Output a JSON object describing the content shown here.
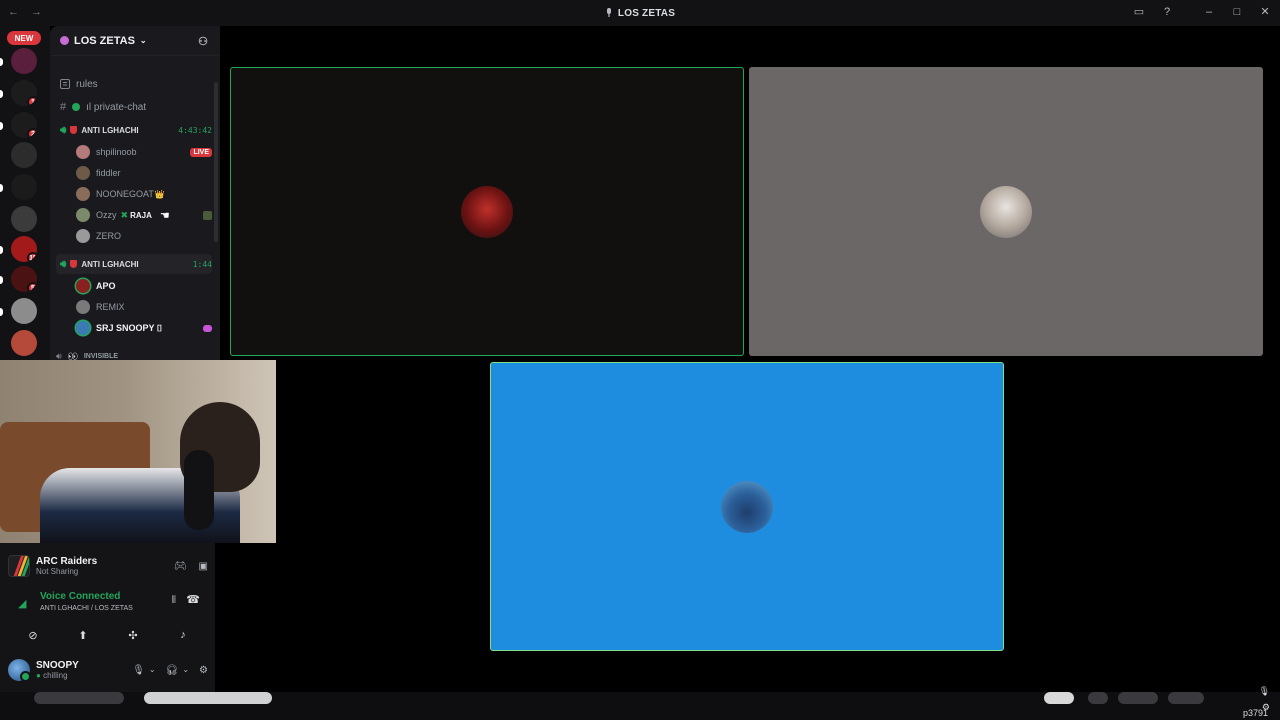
{
  "window": {
    "title": "LOS ZETAS",
    "nav_back": "←",
    "nav_forward": "→",
    "controls": [
      "inbox-icon",
      "help-icon",
      "minimize",
      "maximize",
      "close"
    ]
  },
  "rail": {
    "new_badge": "NEW",
    "servers": [
      {
        "badge": "",
        "color": "#5a1f3c"
      },
      {
        "badge": "1",
        "color": "#1c1c1c"
      },
      {
        "badge": "2",
        "color": "#1c1c1c"
      },
      {
        "badge": "",
        "color": "#2c2c2c"
      },
      {
        "badge": "",
        "color": "#1b1b1b"
      },
      {
        "badge": "",
        "color": "#3b3b3b"
      },
      {
        "badge": "15",
        "color": "#a31a1a"
      },
      {
        "badge": "5",
        "color": "#4a1212"
      },
      {
        "badge": "",
        "color": "#8c8c8c"
      },
      {
        "badge": "",
        "color": "#b54a3a"
      }
    ]
  },
  "sidebar": {
    "server_name": "LOS ZETAS",
    "channels": [
      {
        "label": "rules"
      },
      {
        "label": "ıl private-chat"
      }
    ],
    "voice1": {
      "name": "ANTI LGHACHI",
      "timer": "4:43:42",
      "users": [
        {
          "name": "shpilinoob",
          "tag": "LIVE",
          "color": "#b57a7a"
        },
        {
          "name": "fiddler",
          "tag": "",
          "color": "#6d5b48"
        },
        {
          "name": "NOONEGOAT",
          "tag": "👑",
          "color": "#8a6c5a"
        },
        {
          "name": "Ozzy",
          "tag": "RAJA",
          "color": "#7a8a6a"
        },
        {
          "name": "ZERO",
          "tag": "",
          "color": "#9a9a9a"
        }
      ]
    },
    "voice2": {
      "name": "ANTI LGHACHI",
      "timer": "1:44",
      "users": [
        {
          "name": "APO",
          "tag": "",
          "color": "#8a2020"
        },
        {
          "name": "REMIX",
          "tag": "",
          "color": "#7a7a7a"
        },
        {
          "name": "SRJ SNOOPY ⌷",
          "tag": "",
          "color": "#3a7ab5"
        }
      ]
    },
    "invisible": "INVISIBLE"
  },
  "activity": {
    "game": "ARC Raiders",
    "status": "Not Sharing"
  },
  "voice": {
    "status": "Voice Connected",
    "location": "ANTI LGHACHI / LOS ZETAS"
  },
  "user": {
    "name": "SNOOPY",
    "status": "chilling"
  },
  "tiles": [
    {
      "color": "#120f0f",
      "avatar": "#8b1a1a"
    },
    {
      "color": "#6b6766",
      "avatar": "#d9d4cf"
    },
    {
      "color": "#1e8de0",
      "avatar": "#1f3e6b"
    }
  ],
  "corner_text": "p3791"
}
